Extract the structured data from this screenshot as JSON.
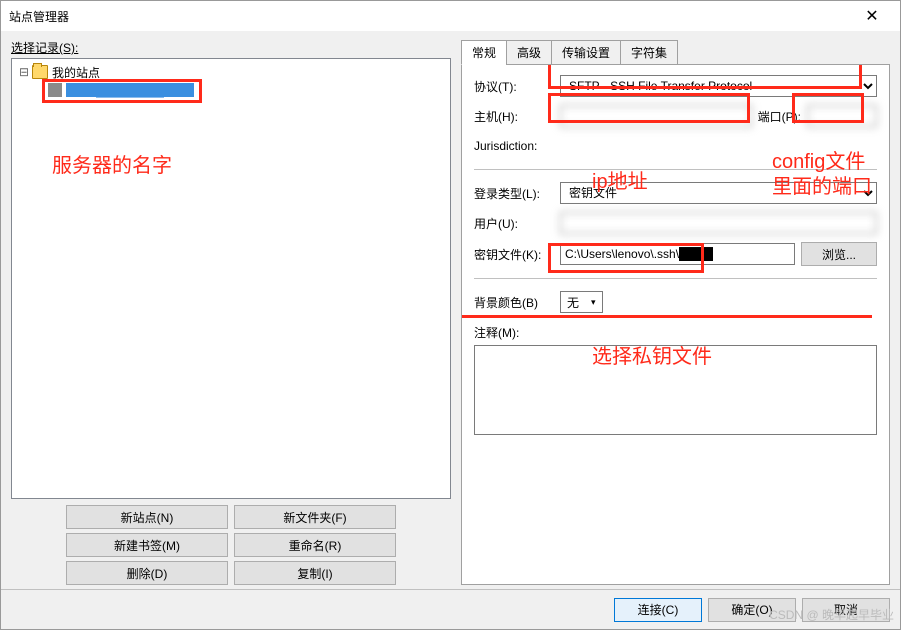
{
  "window": {
    "title": "站点管理器"
  },
  "left": {
    "select_label": "选择记录(S):",
    "root_label": "我的站点",
    "site_label_masked": "████████",
    "buttons": {
      "new_site": "新站点(N)",
      "new_folder": "新文件夹(F)",
      "new_bookmark": "新建书签(M)",
      "rename": "重命名(R)",
      "delete": "删除(D)",
      "copy": "复制(I)"
    }
  },
  "tabs": {
    "general": "常规",
    "advanced": "高级",
    "transfer": "传输设置",
    "charset": "字符集"
  },
  "form": {
    "protocol_label": "协议(T):",
    "protocol_value": "SFTP - SSH File Transfer Protocol",
    "host_label": "主机(H):",
    "host_value": "",
    "port_label": "端口(P):",
    "port_value": "",
    "jurisdiction_label": "Jurisdiction:",
    "logon_type_label": "登录类型(L):",
    "logon_type_value": "密钥文件",
    "user_label": "用户(U):",
    "user_value": "",
    "keyfile_label": "密钥文件(K):",
    "keyfile_value": "C:\\Users\\lenovo\\.ssh\\████",
    "browse": "浏览...",
    "bgcolor_label": "背景颜色(B)",
    "bgcolor_value": "无",
    "comment_label": "注释(M):"
  },
  "bottom": {
    "connect": "连接(C)",
    "ok": "确定(O)",
    "cancel": "取消"
  },
  "annotations": {
    "server_name": "服务器的名字",
    "ip_addr": "ip地址",
    "config_port": "config文件里面的端口",
    "choose_key": "选择私钥文件"
  },
  "watermark": "CSDN @ 晚早起早毕业"
}
